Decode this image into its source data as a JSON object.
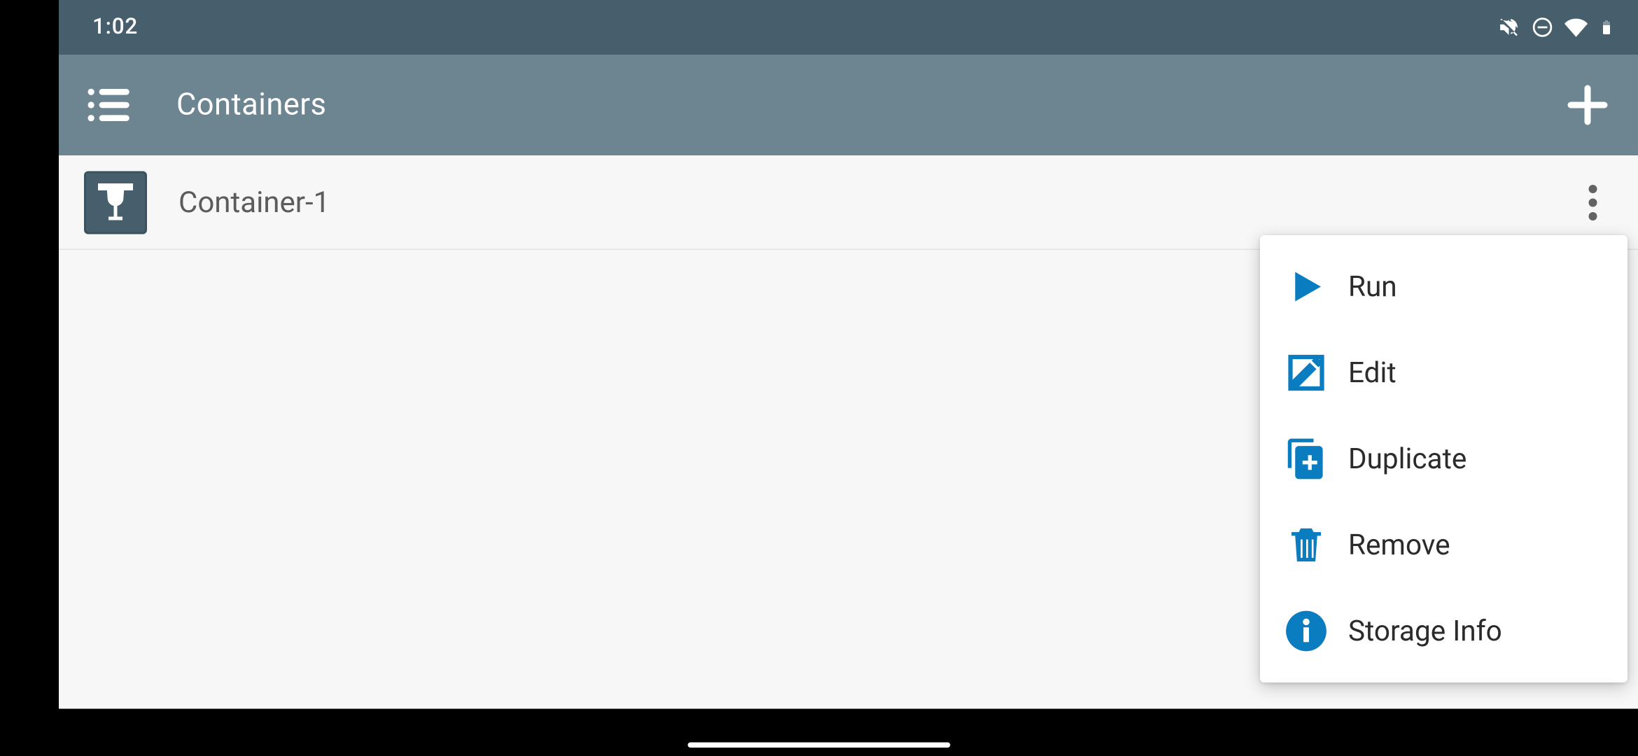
{
  "statusbar": {
    "time": "1:02"
  },
  "appbar": {
    "title": "Containers"
  },
  "list": {
    "items": [
      {
        "label": "Container-1"
      }
    ]
  },
  "menu": {
    "items": [
      {
        "label": "Run",
        "icon": "play-icon"
      },
      {
        "label": "Edit",
        "icon": "edit-icon"
      },
      {
        "label": "Duplicate",
        "icon": "duplicate-icon"
      },
      {
        "label": "Remove",
        "icon": "trash-icon"
      },
      {
        "label": "Storage Info",
        "icon": "info-icon"
      }
    ]
  },
  "colors": {
    "accent": "#0a7dc1",
    "appbar": "#6d8591",
    "statusbar": "#475f6c"
  }
}
